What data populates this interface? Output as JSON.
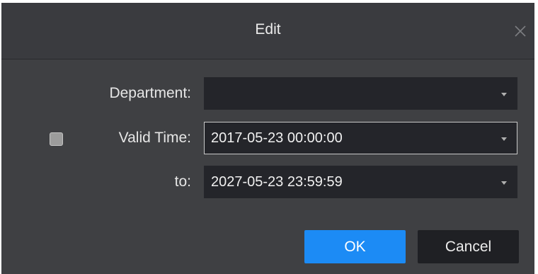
{
  "dialog": {
    "title": "Edit",
    "close_icon": "close-icon"
  },
  "form": {
    "department_label": "Department:",
    "department_value": "",
    "valid_time_label": "Valid Time:",
    "valid_time_checked": false,
    "valid_time_value": "2017-05-23 00:00:00",
    "to_label": "to:",
    "to_value": "2027-05-23 23:59:59"
  },
  "buttons": {
    "ok_label": "OK",
    "cancel_label": "Cancel"
  },
  "colors": {
    "titlebar": "#3a3b3f",
    "body": "#3f4043",
    "field": "#24252a",
    "primary": "#1c8bf5"
  }
}
